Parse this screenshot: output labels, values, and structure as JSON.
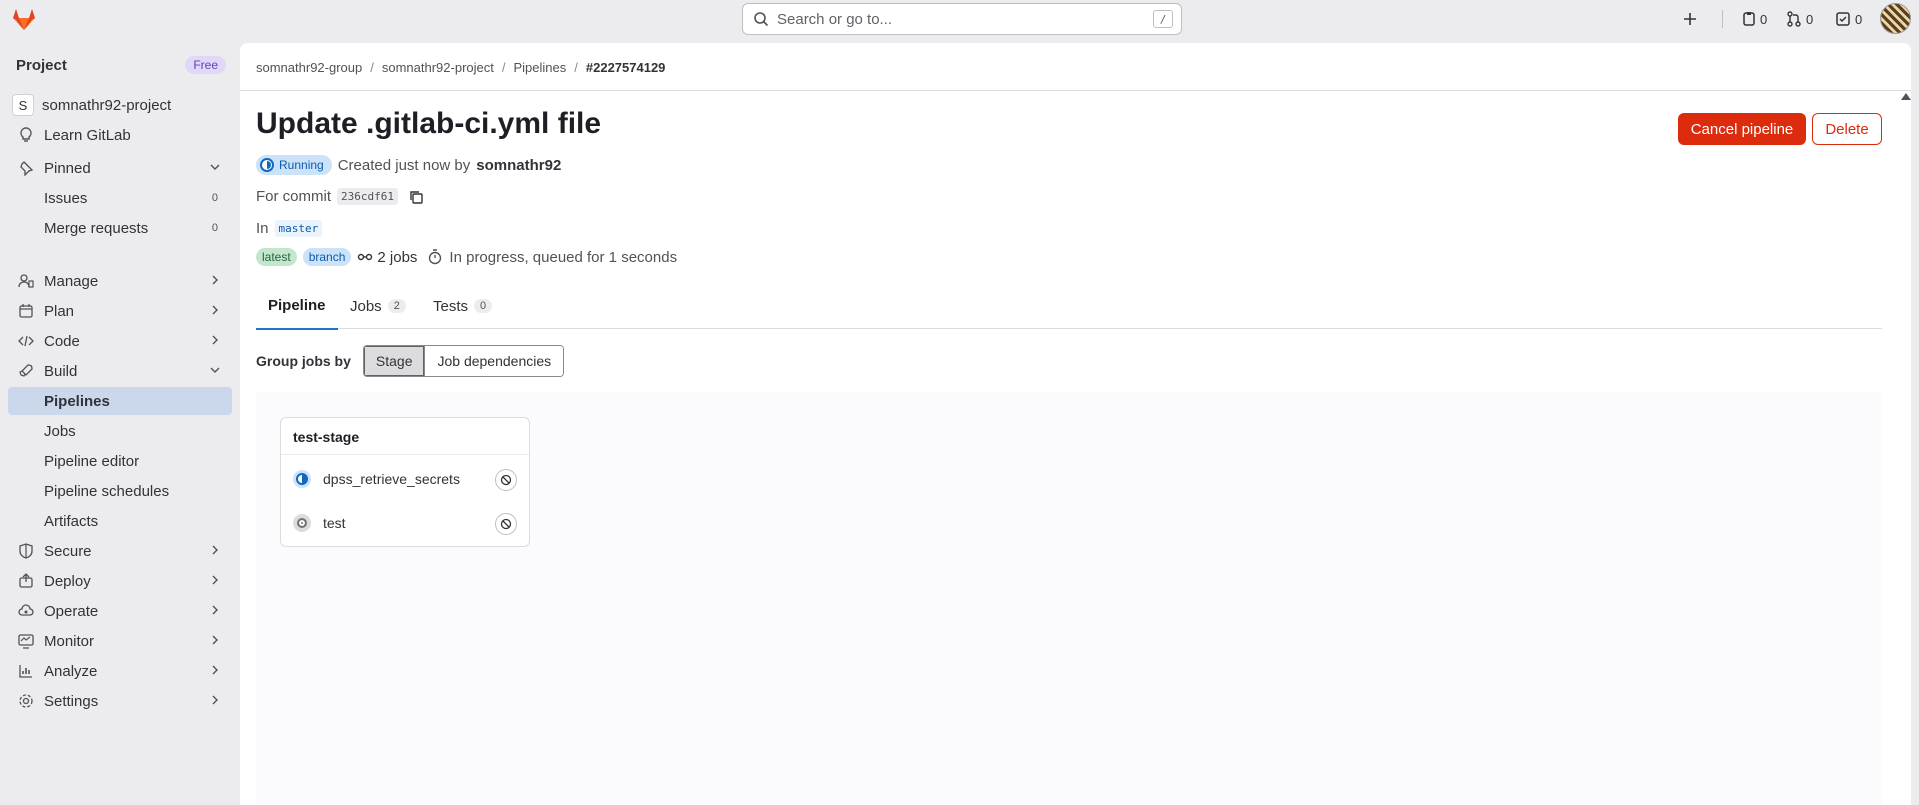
{
  "topbar": {
    "search_placeholder": "Search or go to...",
    "search_shortcut": "/",
    "issues_count": "0",
    "mr_count": "0",
    "todo_count": "0"
  },
  "sidebar": {
    "title": "Project",
    "plan_badge": "Free",
    "project_initial": "S",
    "project_name": "somnathr92-project",
    "learn": "Learn GitLab",
    "pinned": "Pinned",
    "issues": "Issues",
    "issues_count": "0",
    "merge_requests": "Merge requests",
    "merge_requests_count": "0",
    "manage": "Manage",
    "plan": "Plan",
    "code": "Code",
    "build": "Build",
    "pipelines": "Pipelines",
    "jobs": "Jobs",
    "pipeline_editor": "Pipeline editor",
    "pipeline_schedules": "Pipeline schedules",
    "artifacts": "Artifacts",
    "secure": "Secure",
    "deploy": "Deploy",
    "operate": "Operate",
    "monitor": "Monitor",
    "analyze": "Analyze",
    "settings": "Settings"
  },
  "breadcrumb": {
    "group": "somnathr92-group",
    "project": "somnathr92-project",
    "pipelines": "Pipelines",
    "current": "#2227574129"
  },
  "header": {
    "title": "Update .gitlab-ci.yml file",
    "cancel_button": "Cancel pipeline",
    "delete_button": "Delete",
    "status": "Running",
    "created_text": "Created just now by",
    "author": "somnathr92",
    "for_commit": "For commit",
    "commit_sha": "236cdf61",
    "in_label": "In",
    "branch": "master",
    "tag_latest": "latest",
    "tag_branch": "branch",
    "jobs_link": "2 jobs",
    "duration_text": "In progress, queued for 1 seconds"
  },
  "tabs": {
    "pipeline": "Pipeline",
    "jobs": "Jobs",
    "jobs_count": "2",
    "tests": "Tests",
    "tests_count": "0"
  },
  "group_by": {
    "label": "Group jobs by",
    "stage": "Stage",
    "dependencies": "Job dependencies"
  },
  "stage": {
    "name": "test-stage",
    "jobs": [
      {
        "name": "dpss_retrieve_secrets",
        "status": "running"
      },
      {
        "name": "test",
        "status": "created"
      }
    ]
  },
  "colors": {
    "danger": "#dd2b0e",
    "running": "#1068bf",
    "active_nav": "#cbd8ec"
  }
}
